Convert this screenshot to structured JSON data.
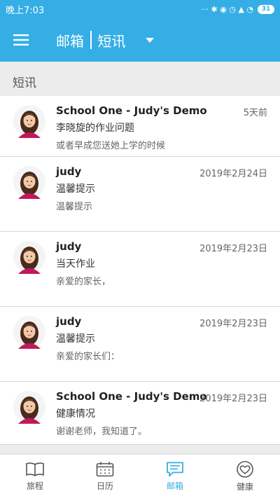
{
  "status_bar": {
    "time": "晚上7:03",
    "icons_text": "··· ✱ ◉ ◷ ▲ ◔",
    "battery": "31"
  },
  "app_bar": {
    "title_left": "邮箱",
    "title_right": "短讯",
    "menu_icon": "hamburger-icon",
    "dropdown_icon": "caret-down-icon"
  },
  "section": {
    "title": "短讯"
  },
  "messages": [
    {
      "sender": "School One - Judy's Demo",
      "date": "5天前",
      "subject": "李晓旋的作业问题",
      "preview": "或者早成您送她上学的时候"
    },
    {
      "sender": "judy",
      "date": "2019年2月24日",
      "subject": "温馨提示",
      "preview": "温馨提示"
    },
    {
      "sender": "judy",
      "date": "2019年2月23日",
      "subject": "当天作业",
      "preview": "亲爱的家长，"
    },
    {
      "sender": "judy",
      "date": "2019年2月23日",
      "subject": "温馨提示",
      "preview": "亲爱的家长们："
    },
    {
      "sender": "School One - Judy's Demo",
      "date": "2019年2月23日",
      "subject": "健康情况",
      "preview": "谢谢老师，我知道了。"
    }
  ],
  "bottom_nav": [
    {
      "label": "旅程",
      "icon": "book-icon",
      "active": false
    },
    {
      "label": "日历",
      "icon": "calendar-icon",
      "active": false
    },
    {
      "label": "邮箱",
      "icon": "message-icon",
      "active": true
    },
    {
      "label": "健康",
      "icon": "heart-icon",
      "active": false
    }
  ],
  "colors": {
    "primary": "#35aee6",
    "background": "#ececec"
  }
}
